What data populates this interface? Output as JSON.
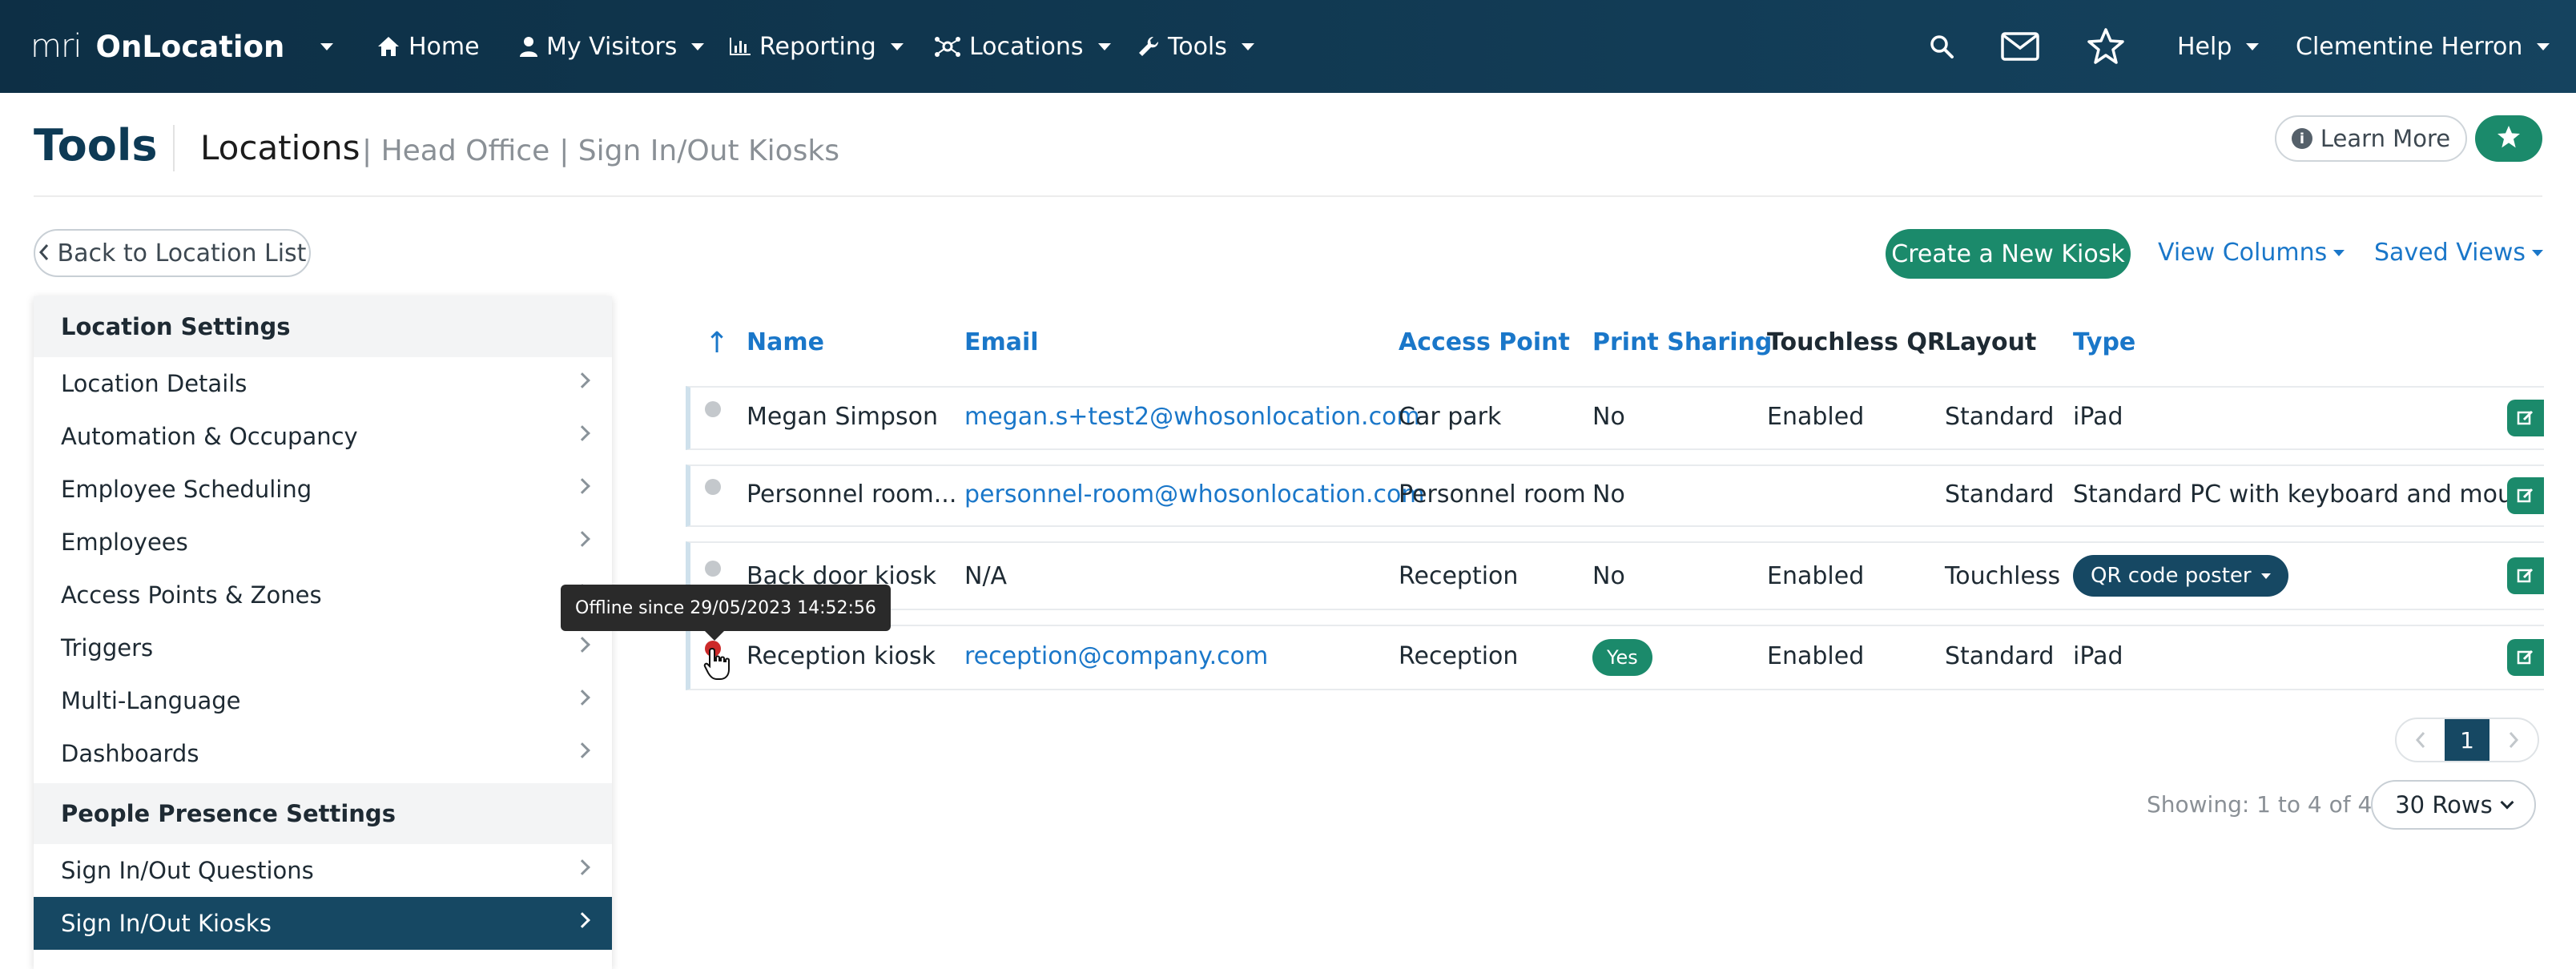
{
  "nav": {
    "logo": "mri",
    "app_name": "OnLocation",
    "items": [
      {
        "label": "Home",
        "icon": "home-icon"
      },
      {
        "label": "My Visitors",
        "icon": "user-icon"
      },
      {
        "label": "Reporting",
        "icon": "chart-icon"
      },
      {
        "label": "Locations",
        "icon": "network-icon"
      },
      {
        "label": "Tools",
        "icon": "wrench-icon"
      }
    ],
    "help": "Help",
    "user": "Clementine Herron"
  },
  "header": {
    "title": "Tools",
    "breadcrumb_main": "Locations",
    "breadcrumb_rest": [
      "| Head Office",
      "| Sign In/Out Kiosks"
    ],
    "learn_more": "Learn More"
  },
  "back_button": "Back to Location List",
  "sidebar": {
    "section1": "Location Settings",
    "items1": [
      "Location Details",
      "Automation & Occupancy",
      "Employee Scheduling",
      "Employees",
      "Access Points & Zones",
      "Triggers",
      "Multi-Language",
      "Dashboards"
    ],
    "section2": "People Presence Settings",
    "items2": [
      "Sign In/Out Questions",
      "Sign In/Out Kiosks"
    ]
  },
  "toolbar": {
    "create": "Create a New Kiosk",
    "view_columns": "View Columns",
    "saved_views": "Saved Views"
  },
  "table": {
    "sort_indicator": "↑",
    "headers": [
      "Name",
      "Email",
      "Access Point",
      "Print Sharing",
      "Touchless QR",
      "Layout",
      "Type"
    ],
    "rows": [
      {
        "name": "Megan Simpson",
        "email": "megan.s+test2@whosonlocation.com",
        "access_point": "Car park",
        "print_sharing": "No",
        "touchless_qr": "Enabled",
        "layout": "Standard",
        "type": "iPad",
        "status": "unknown"
      },
      {
        "name": "Personnel room...",
        "email": "personnel-room@whosonlocation.com",
        "access_point": "Personnel room",
        "print_sharing": "No",
        "touchless_qr": "",
        "layout": "Standard",
        "type": "Standard PC with keyboard and mouse",
        "status": "unknown"
      },
      {
        "name": "Back door kiosk",
        "email": "N/A",
        "access_point": "Reception",
        "print_sharing": "No",
        "touchless_qr": "Enabled",
        "layout": "Touchless",
        "type": "QR code poster",
        "status": "unknown"
      },
      {
        "name": "Reception kiosk",
        "email": "reception@company.com",
        "access_point": "Reception",
        "print_sharing": "Yes",
        "touchless_qr": "Enabled",
        "layout": "Standard",
        "type": "iPad",
        "status": "offline"
      }
    ]
  },
  "tooltip": "Offline since 29/05/2023 14:52:56",
  "pagination": {
    "current_page": "1",
    "showing": "Showing: 1 to 4 of 4",
    "rows_per_page": "30 Rows"
  },
  "colors": {
    "nav_bg": "#0d2f45",
    "primary_green": "#1b8a6b",
    "link_blue": "#1a77c9",
    "dark_navy": "#164863",
    "offline_red": "#cc2a2a"
  }
}
